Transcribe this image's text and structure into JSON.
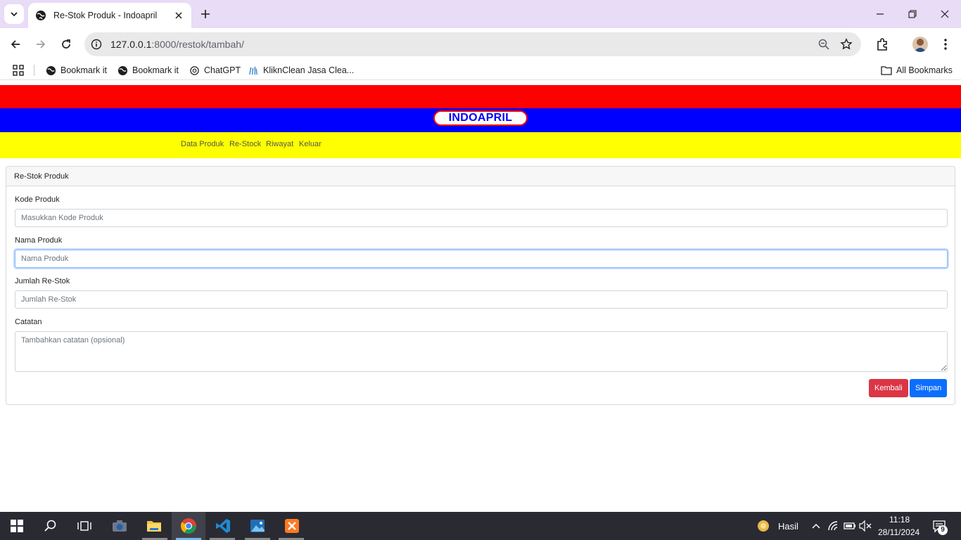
{
  "browser": {
    "tab_title": "Re-Stok Produk - Indoapril",
    "url_host": "127.0.0.1",
    "url_rest": ":8000/restok/tambah/",
    "bookmarks": [
      {
        "label": "Bookmark it",
        "icon": "globe-icon"
      },
      {
        "label": "Bookmark it",
        "icon": "globe-icon"
      },
      {
        "label": "ChatGPT",
        "icon": "chatgpt-icon"
      },
      {
        "label": "KliknClean Jasa Clea...",
        "icon": "kliknclean-icon"
      }
    ],
    "all_bookmarks": "All Bookmarks"
  },
  "site": {
    "brand": "INDOAPRIL",
    "nav": [
      "Data Produk",
      "Re-Stock",
      "Riwayat",
      "Keluar"
    ],
    "colors": {
      "red": "#ff0000",
      "blue": "#0000ff",
      "yellow": "#ffff00"
    }
  },
  "form": {
    "header": "Re-Stok Produk",
    "kode_label": "Kode Produk",
    "kode_placeholder": "Masukkan Kode Produk",
    "nama_label": "Nama Produk",
    "nama_placeholder": "Nama Produk",
    "jumlah_label": "Jumlah Re-Stok",
    "jumlah_placeholder": "Jumlah Re-Stok",
    "catatan_label": "Catatan",
    "catatan_placeholder": "Tambahkan catatan (opsional)",
    "back_button": "Kembali",
    "save_button": "Simpan"
  },
  "taskbar": {
    "weather": "Hasil",
    "time": "11:18",
    "date": "28/11/2024",
    "notifications": "9"
  }
}
